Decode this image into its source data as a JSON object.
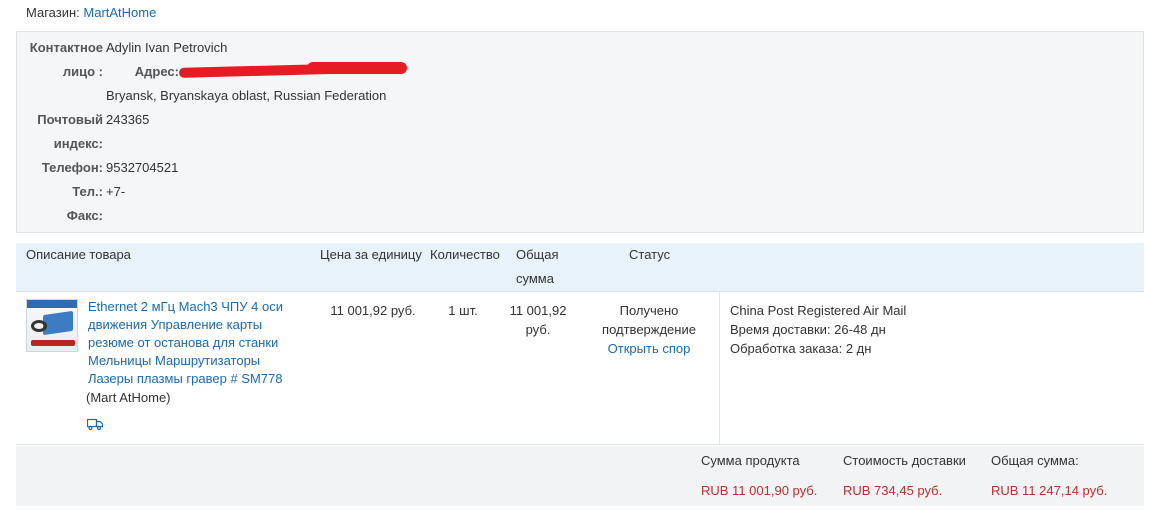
{
  "store": {
    "label": "Магазин:",
    "name": "MartAtHome"
  },
  "contact": {
    "person_label_1": "Контактное",
    "person_label_2": "лицо :",
    "person_value": "Adylin Ivan Petrovich",
    "address_label": "Адрес:",
    "address_line2": "Bryansk, Bryanskaya oblast, Russian Federation",
    "zip_label_1": "Почтовый",
    "zip_label_2": "индекс:",
    "zip_value": "243365",
    "phone_label": "Телефон:",
    "phone_value": "9532704521",
    "tel_label": "Тел.:",
    "tel_value": "+7-",
    "fax_label": "Факс:"
  },
  "table": {
    "headers": {
      "description": "Описание товара",
      "unit_price": "Цена за единицу",
      "quantity": "Количество",
      "total_1": "Общая",
      "total_2": "сумма",
      "status": "Статус"
    },
    "item": {
      "name": "Ethernet 2 мГц Mach3 ЧПУ 4 оси движения Управление карты резюме от останова для станки Мельницы Маршрутизаторы Лазеры плазмы гравер # SM778",
      "shop": "(Mart AtHome)",
      "unit_price": "11 001,92 руб.",
      "quantity": "1 шт.",
      "total_1": "11 001,92",
      "total_2": "руб.",
      "status_1": "Получено",
      "status_2": "подтверждение",
      "dispute_link": "Открыть спор",
      "shipping_method": "China Post Registered Air Mail",
      "delivery_time": "Время доставки: 26-48 дн",
      "processing_time": "Обработка заказа: 2 дн"
    }
  },
  "summary": {
    "product_label": "Сумма продукта",
    "product_value": "RUB 11 001,90 руб.",
    "shipping_label": "Стоимость доставки",
    "shipping_value": "RUB 734,45 руб.",
    "total_label": "Общая сумма:",
    "total_value": "RUB 11 247,14 руб."
  },
  "colors": {
    "link": "#1a6ab4",
    "price": "#b8312f",
    "header_bg": "#e8f2fb",
    "redaction": "#e51c24"
  }
}
